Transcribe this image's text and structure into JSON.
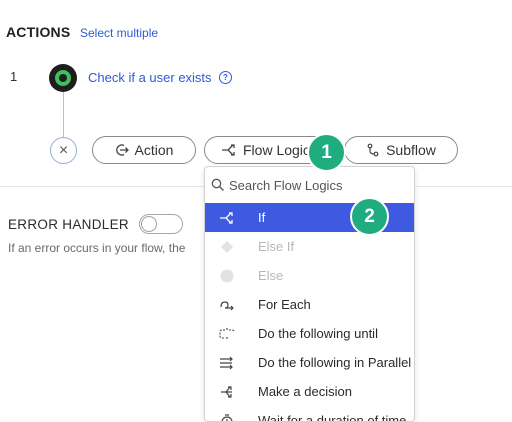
{
  "header": {
    "title": "ACTIONS",
    "select_multiple": "Select multiple"
  },
  "step": {
    "number": "1",
    "label": "Check if a user exists",
    "help": "?"
  },
  "buttons": {
    "close": "×",
    "action": "Action",
    "flow_logic": "Flow Logic",
    "subflow": "Subflow"
  },
  "error_handler": {
    "title": "ERROR HANDLER",
    "description": "If an error occurs in your flow, the",
    "enabled": false
  },
  "dropdown": {
    "search_placeholder": "Search Flow Logics",
    "items": [
      {
        "label": "If",
        "icon": "branch-icon",
        "state": "selected"
      },
      {
        "label": "Else If",
        "icon": "diamond-icon",
        "state": "disabled"
      },
      {
        "label": "Else",
        "icon": "circle-icon",
        "state": "disabled"
      },
      {
        "label": "For Each",
        "icon": "loop-arrow-icon",
        "state": "enabled"
      },
      {
        "label": "Do the following until",
        "icon": "repeat-icon",
        "state": "enabled"
      },
      {
        "label": "Do the following in Parallel",
        "icon": "parallel-arrows-icon",
        "state": "enabled"
      },
      {
        "label": "Make a decision",
        "icon": "decision-icon",
        "state": "enabled"
      },
      {
        "label": "Wait for a duration of time",
        "icon": "timer-icon",
        "state": "enabled"
      }
    ]
  },
  "annotations": {
    "badge1": "1",
    "badge2": "2"
  },
  "colors": {
    "accent": "#3d5ae0",
    "link": "#2f5bd3",
    "badge": "#1fad7f",
    "node_green": "#3fbf5f"
  }
}
